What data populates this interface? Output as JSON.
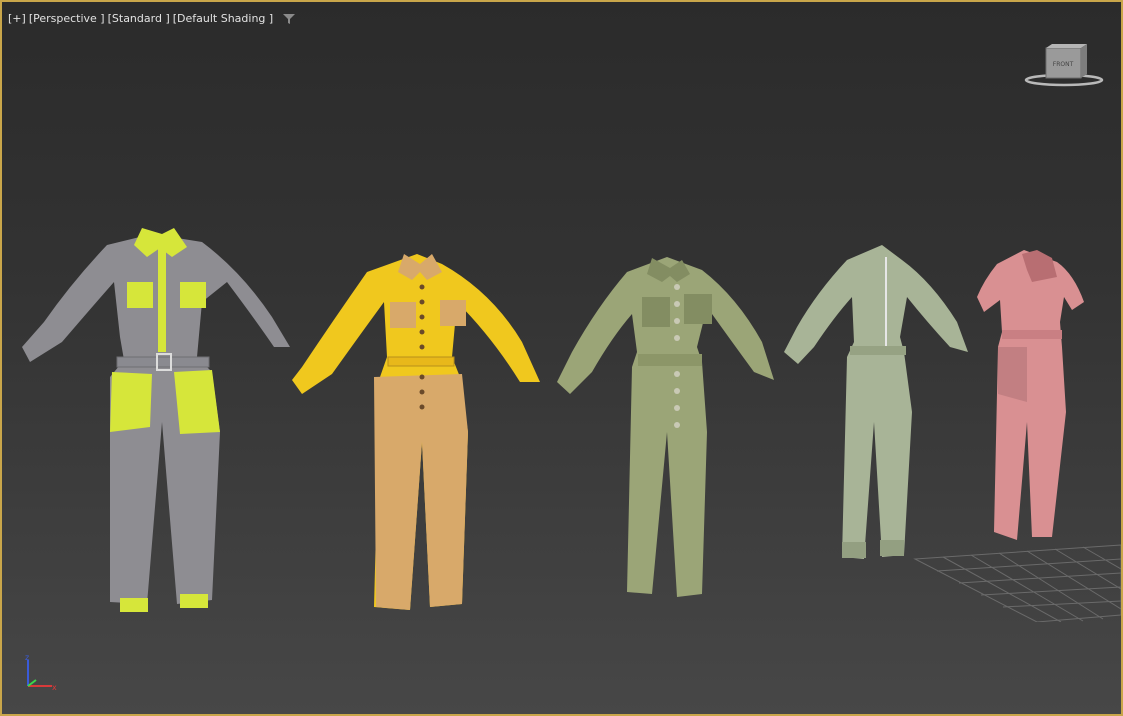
{
  "viewport": {
    "label_plus": "[+]",
    "label_view": "[Perspective ]",
    "label_mode": "[Standard ]",
    "label_shading": "[Default Shading ]"
  },
  "viewcube": {
    "face_label": "FRONT"
  },
  "axis": {
    "z_label": "z",
    "x_label": "x"
  },
  "colors": {
    "border": "#c9a64a",
    "suit1_base": "#8e8d92",
    "suit1_accent": "#d6e63a",
    "suit2_top": "#f0c81e",
    "suit2_bottom": "#d8a96a",
    "suit3": "#9ba577",
    "suit4": "#a8b497",
    "suit5": "#d99092"
  },
  "icons": [
    "filter-icon",
    "viewcube-icon",
    "axis-tripod-icon",
    "home-grid"
  ]
}
